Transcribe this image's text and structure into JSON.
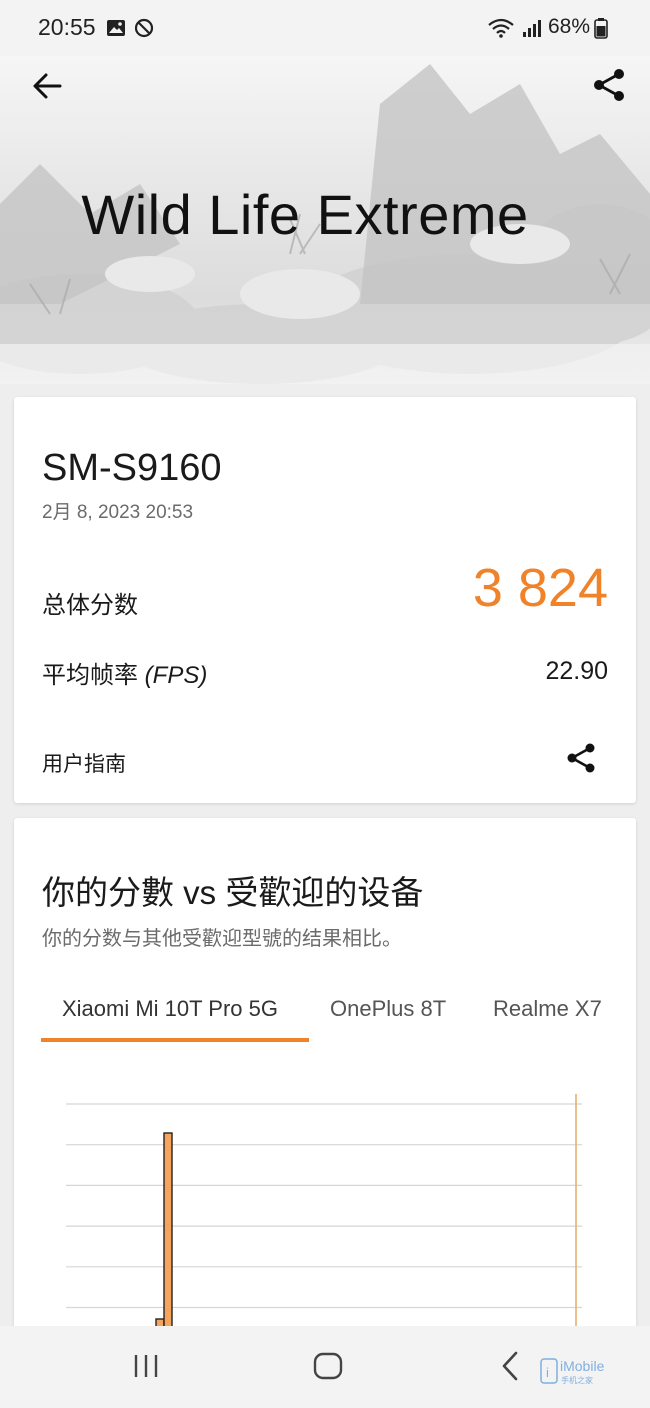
{
  "status_bar": {
    "time": "20:55",
    "battery": "68%",
    "icons": [
      "image-icon",
      "no-disturb-icon",
      "wifi-icon",
      "signal-icon",
      "battery-icon"
    ]
  },
  "header": {
    "title": "Wild Life Extreme",
    "back_icon": "arrow-left-icon",
    "share_icon": "share-icon"
  },
  "result": {
    "device": "SM-S9160",
    "date": "2月 8, 2023 20:53",
    "score_label": "总体分数",
    "score_value": "3 824",
    "fps_label_prefix": "平均帧率 ",
    "fps_label_unit": "(FPS)",
    "fps_value": "22.90",
    "guide_label": "用户指南",
    "accent_color": "#f0832a"
  },
  "compare": {
    "title": "你的分數 vs 受歡迎的设备",
    "subtitle": "你的分数与其他受歡迎型號的结果相比。",
    "tabs": [
      "Xiaomi Mi 10T Pro 5G",
      "OnePlus 8T",
      "Realme X7"
    ],
    "selected_tab": "Xiaomi Mi 10T Pro 5G"
  },
  "chart_data": {
    "type": "bar",
    "note_visible": "histogram partially visible, no axis labels shown",
    "grid": true,
    "bars_relative_height": [
      0.02,
      0.33,
      0.95
    ],
    "marker_line": true
  },
  "nav_bar": {
    "icons": [
      "recent-apps-icon",
      "home-icon",
      "back-icon"
    ],
    "watermark": "iMobile",
    "watermark_sub": "手机之家"
  }
}
